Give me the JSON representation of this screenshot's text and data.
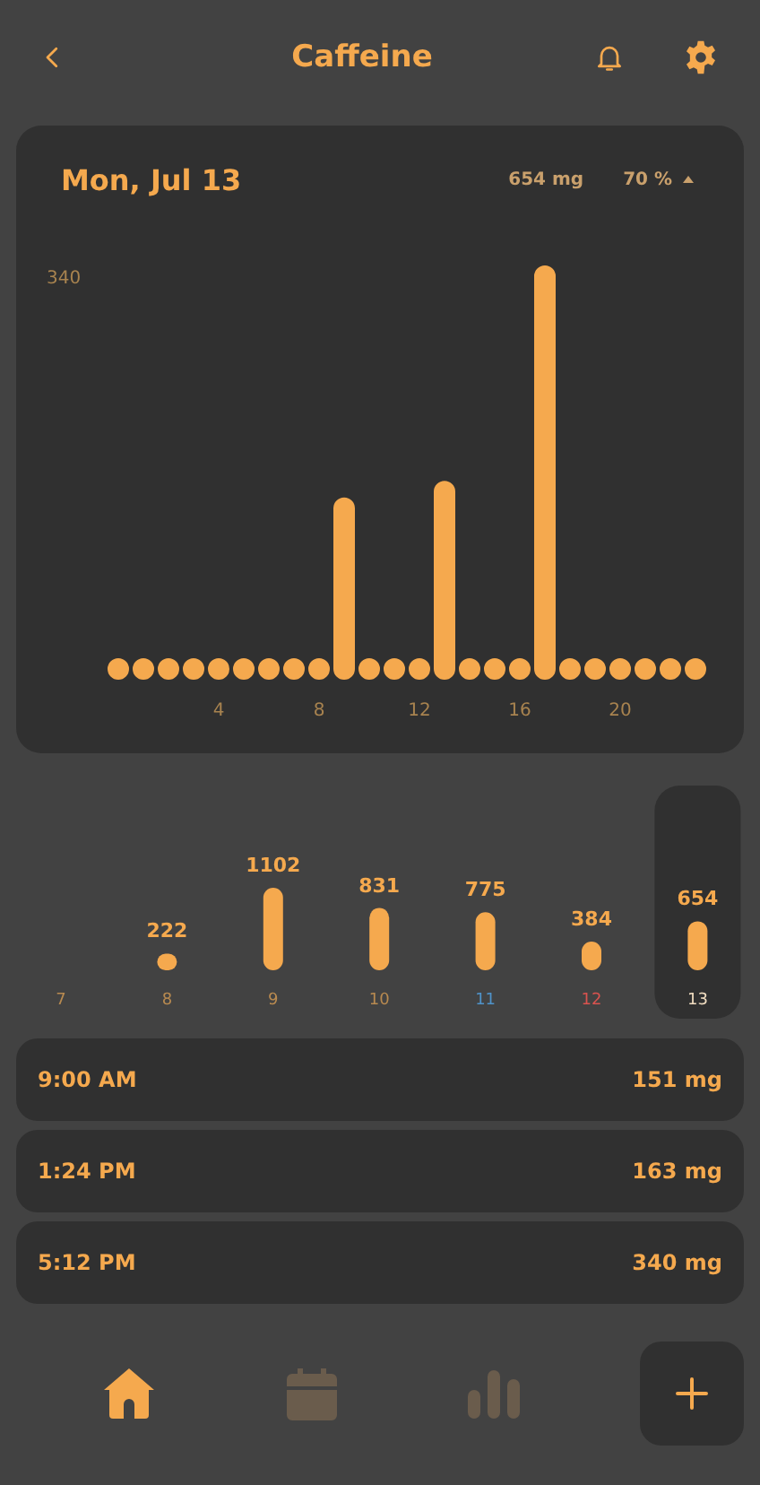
{
  "header": {
    "title": "Caffeine"
  },
  "day_card": {
    "date": "Mon, Jul 13",
    "total": "654 mg",
    "percent": "70 %",
    "max_label": "340",
    "hour_labels": [
      "4",
      "8",
      "12",
      "16",
      "20"
    ]
  },
  "week": {
    "chart_data": {
      "type": "bar",
      "categories": [
        "7",
        "8",
        "9",
        "10",
        "11",
        "12",
        "13"
      ],
      "values": [
        null,
        222,
        1102,
        831,
        775,
        384,
        654
      ],
      "data_labels": true
    },
    "days": [
      {
        "color": "#b88a50",
        "selected": false
      },
      {
        "color": "#b88a50",
        "selected": false
      },
      {
        "color": "#b88a50",
        "selected": false
      },
      {
        "color": "#b88a50",
        "selected": false
      },
      {
        "color": "#4f93c9",
        "selected": false
      },
      {
        "color": "#d9534f",
        "selected": false
      },
      {
        "color": "#f0dcc0",
        "selected": true
      }
    ]
  },
  "entries": [
    {
      "time": "9:00 AM",
      "amount": "151 mg"
    },
    {
      "time": "1:24 PM",
      "amount": "163 mg"
    },
    {
      "time": "5:12 PM",
      "amount": "340 mg"
    }
  ],
  "nav": [
    {
      "kind": "home",
      "selected": true
    },
    {
      "kind": "calendar",
      "selected": false
    },
    {
      "kind": "stats",
      "selected": false
    }
  ]
}
